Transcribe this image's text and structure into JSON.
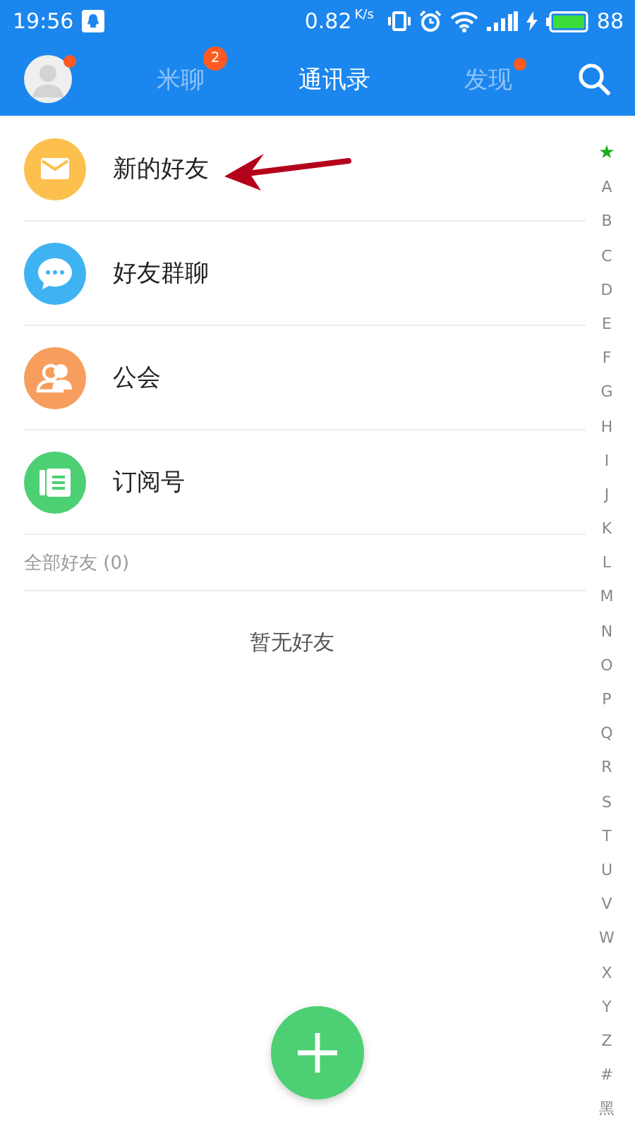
{
  "status_bar": {
    "time": "19:56",
    "speed": "0.82",
    "speed_unit": "K/s",
    "battery": "88"
  },
  "header": {
    "avatar_dot": true,
    "tabs": [
      {
        "label": "米聊",
        "selected": false,
        "badge": "2",
        "dot": false
      },
      {
        "label": "通讯录",
        "selected": true,
        "dot": false
      },
      {
        "label": "发现",
        "selected": false,
        "dot": true
      }
    ]
  },
  "entries": [
    {
      "label": "新的好友",
      "kind": "mail",
      "color": "#fdc04e"
    },
    {
      "label": "好友群聊",
      "kind": "chat",
      "color": "#3fb3f2"
    },
    {
      "label": "公会",
      "kind": "guild",
      "color": "#f79d5e"
    },
    {
      "label": "订阅号",
      "kind": "news",
      "color": "#4cd073"
    }
  ],
  "annotation": {
    "kind": "arrow"
  },
  "section": {
    "title": "全部好友 (0)",
    "empty_text": "暂无好友"
  },
  "index": [
    {
      "label": "★",
      "kind": "star"
    },
    {
      "label": "A",
      "kind": "letter"
    },
    {
      "label": "B",
      "kind": "letter"
    },
    {
      "label": "C",
      "kind": "letter"
    },
    {
      "label": "D",
      "kind": "letter"
    },
    {
      "label": "E",
      "kind": "letter"
    },
    {
      "label": "F",
      "kind": "letter"
    },
    {
      "label": "G",
      "kind": "letter"
    },
    {
      "label": "H",
      "kind": "letter"
    },
    {
      "label": "I",
      "kind": "letter"
    },
    {
      "label": "J",
      "kind": "letter"
    },
    {
      "label": "K",
      "kind": "letter"
    },
    {
      "label": "L",
      "kind": "letter"
    },
    {
      "label": "M",
      "kind": "letter"
    },
    {
      "label": "N",
      "kind": "letter"
    },
    {
      "label": "O",
      "kind": "letter"
    },
    {
      "label": "P",
      "kind": "letter"
    },
    {
      "label": "Q",
      "kind": "letter"
    },
    {
      "label": "R",
      "kind": "letter"
    },
    {
      "label": "S",
      "kind": "letter"
    },
    {
      "label": "T",
      "kind": "letter"
    },
    {
      "label": "U",
      "kind": "letter"
    },
    {
      "label": "V",
      "kind": "letter"
    },
    {
      "label": "W",
      "kind": "letter"
    },
    {
      "label": "X",
      "kind": "letter"
    },
    {
      "label": "Y",
      "kind": "letter"
    },
    {
      "label": "Z",
      "kind": "letter"
    },
    {
      "label": "#",
      "kind": "letter"
    },
    {
      "label": "黑",
      "kind": "letter"
    }
  ]
}
